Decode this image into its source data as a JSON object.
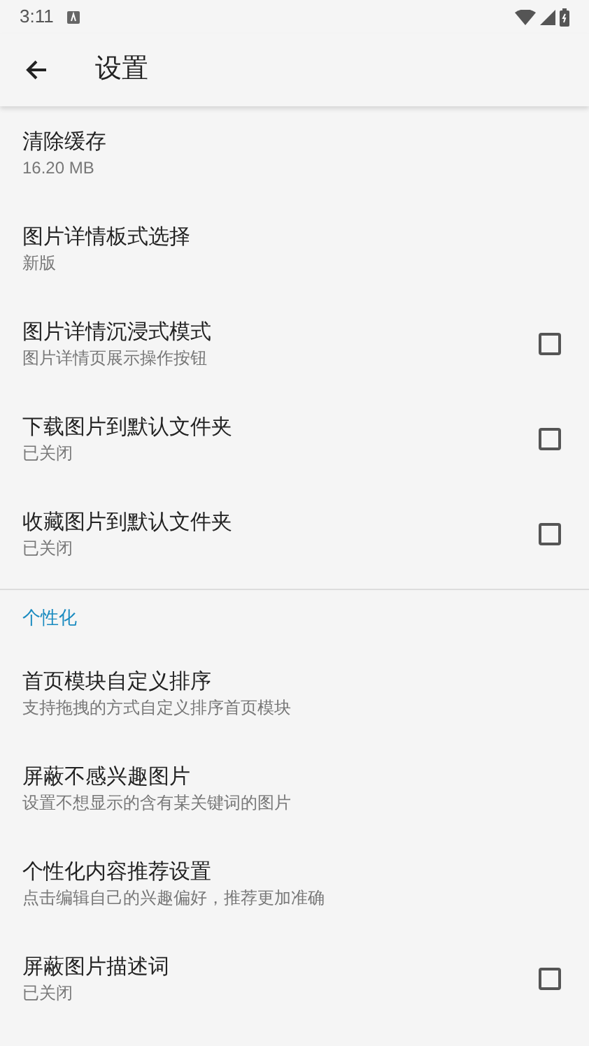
{
  "status_bar": {
    "time": "3:11"
  },
  "app_bar": {
    "title": "设置"
  },
  "sections": [
    {
      "items": [
        {
          "kind": "plain",
          "title": "清除缓存",
          "summary": "16.20 MB"
        },
        {
          "kind": "plain",
          "title": "图片详情板式选择",
          "summary": "新版"
        },
        {
          "kind": "checkbox",
          "title": "图片详情沉浸式模式",
          "summary": "图片详情页展示操作按钮",
          "checked": false
        },
        {
          "kind": "checkbox",
          "title": "下载图片到默认文件夹",
          "summary": "已关闭",
          "checked": false
        },
        {
          "kind": "checkbox",
          "title": "收藏图片到默认文件夹",
          "summary": "已关闭",
          "checked": false
        }
      ]
    },
    {
      "header": "个性化",
      "items": [
        {
          "kind": "plain",
          "title": "首页模块自定义排序",
          "summary": "支持拖拽的方式自定义排序首页模块"
        },
        {
          "kind": "plain",
          "title": "屏蔽不感兴趣图片",
          "summary": "设置不想显示的含有某关键词的图片"
        },
        {
          "kind": "plain",
          "title": "个性化内容推荐设置",
          "summary": "点击编辑自己的兴趣偏好，推荐更加准确"
        },
        {
          "kind": "checkbox",
          "title": "屏蔽图片描述词",
          "summary": "已关闭",
          "checked": false
        }
      ]
    }
  ]
}
